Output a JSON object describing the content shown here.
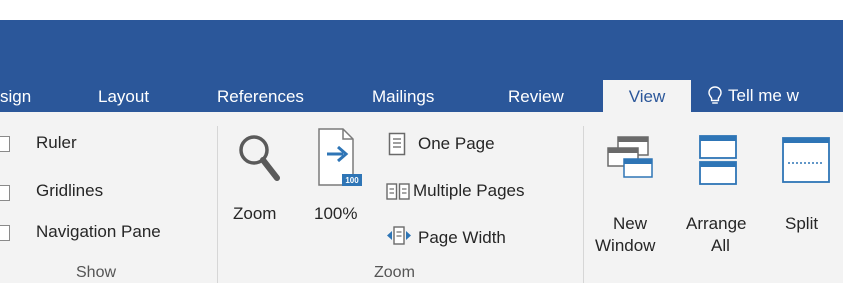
{
  "tabs": [
    {
      "label": "sign"
    },
    {
      "label": "Layout"
    },
    {
      "label": "References"
    },
    {
      "label": "Mailings"
    },
    {
      "label": "Review"
    },
    {
      "label": "View"
    },
    {
      "label": "Tell me w"
    }
  ],
  "show_group": {
    "items": [
      {
        "label": "Ruler",
        "checked": false
      },
      {
        "label": "Gridlines",
        "checked": false
      },
      {
        "label": "Navigation Pane",
        "checked": false
      }
    ],
    "group_label": "Show"
  },
  "zoom_group": {
    "zoom_label": "Zoom",
    "hundred_label": "100%",
    "hundred_badge": "100",
    "one_page_label": "One Page",
    "multiple_pages_label": "Multiple Pages",
    "page_width_label": "Page Width",
    "group_label": "Zoom"
  },
  "window_group": {
    "new_window_line1": "New",
    "new_window_line2": "Window",
    "arrange_all_line1": "Arrange",
    "arrange_all_line2": "All",
    "split_label": "Split"
  },
  "colors": {
    "accent": "#2b579a",
    "ribbon_bg": "#f3f3f3",
    "icon_blue": "#2e75b6"
  }
}
